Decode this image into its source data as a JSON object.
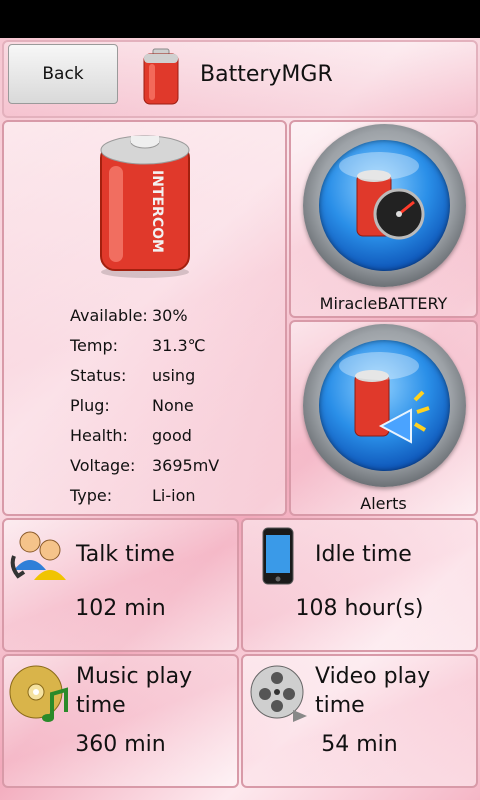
{
  "header": {
    "back_label": "Back",
    "app_title": "BatteryMGR"
  },
  "battery_brand": "INTERCOM",
  "battery_info": [
    {
      "label": "Available:",
      "value": "30%"
    },
    {
      "label": "Temp:",
      "value": "31.3℃"
    },
    {
      "label": "Status:",
      "value": "using"
    },
    {
      "label": "Plug:",
      "value": "None"
    },
    {
      "label": "Health:",
      "value": "good"
    },
    {
      "label": "Voltage:",
      "value": "3695mV"
    },
    {
      "label": "Type:",
      "value": "Li-ion"
    }
  ],
  "tiles": {
    "miracle": {
      "label": "MiracleBATTERY",
      "icon": "battery-speedometer-icon"
    },
    "alerts": {
      "label": "Alerts",
      "icon": "battery-megaphone-icon"
    }
  },
  "stats": {
    "talk": {
      "title": "Talk time",
      "value": "102 min",
      "icon": "contacts-icon"
    },
    "idle": {
      "title": "Idle time",
      "value": "108 hour(s)",
      "icon": "phone-icon"
    },
    "music": {
      "title": "Music play time",
      "value": "360 min",
      "icon": "music-disc-icon"
    },
    "video": {
      "title": "Video play time",
      "value": "54 min",
      "icon": "film-reel-icon"
    }
  },
  "colors": {
    "battery_red": "#e0392b",
    "battery_cap": "#d8d8d8",
    "button_blue": "#2a8fe8",
    "background_pink": "#f6c3cf"
  }
}
